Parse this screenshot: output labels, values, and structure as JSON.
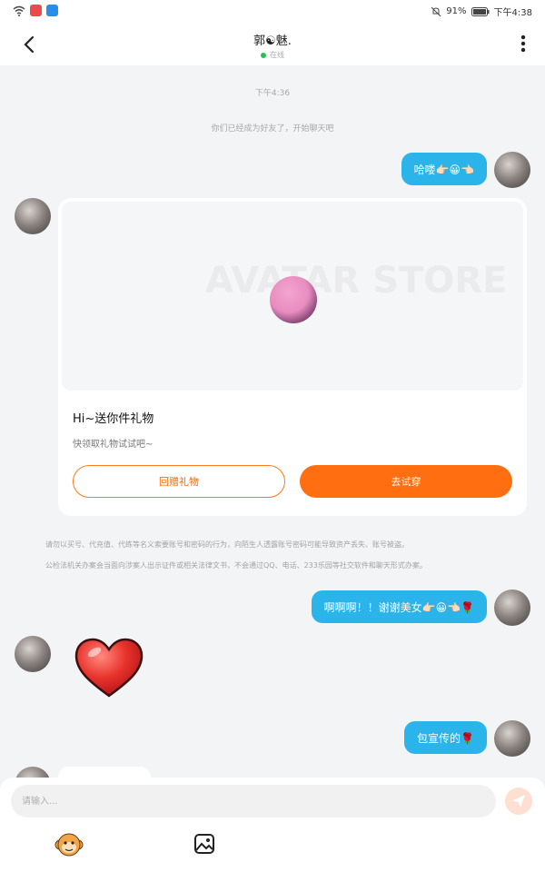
{
  "status_bar": {
    "battery": "91%",
    "time": "下午4:38"
  },
  "header": {
    "title": "郭☯魅.",
    "status": "在线"
  },
  "chat": {
    "timestamp": "下午4:36",
    "system_notice": "你们已经成为好友了，开始聊天吧",
    "messages": [
      {
        "text": "哈喽👉🏻😀👈🏻"
      },
      {
        "text": "啊啊啊！！谢谢美女👉🏻😀👈🏻🌹"
      },
      {
        "text": "包宣传的🌹"
      }
    ],
    "gift_card": {
      "watermark": "AVATAR STORE",
      "title": "Hi~送你件礼物",
      "subtitle": "快领取礼物试试吧~",
      "return_gift_label": "回赠礼物",
      "try_label": "去试穿"
    },
    "warning_lines": [
      "请勿以买号、代充值、代练等名义索要账号和密码的行为，向陌生人透露账号密码可能导致资产丢失、账号被盗。",
      "公检法机关办案会当面向涉案人出示证件或相关法律文书，不会通过QQ、电话、233乐园等社交软件和聊天形式办案。"
    ]
  },
  "input": {
    "placeholder": "请输入..."
  },
  "colors": {
    "outgoing_bubble": "#2ab4ea",
    "accent_orange": "#ff6f12",
    "online_green": "#27c24c"
  }
}
